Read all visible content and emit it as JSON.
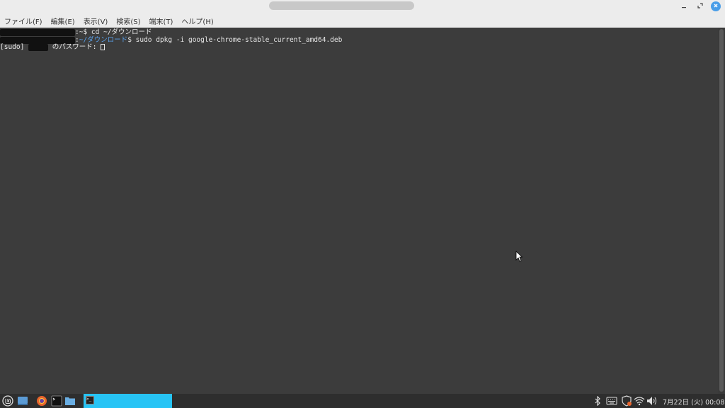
{
  "window": {
    "menu": [
      "ファイル(F)",
      "編集(E)",
      "表示(V)",
      "検索(S)",
      "端末(T)",
      "ヘルプ(H)"
    ]
  },
  "terminal": {
    "line1": {
      "prompt_sep": ":",
      "rest": "~$ cd ~/ダウンロード"
    },
    "line2": {
      "prompt_sep": ":",
      "path": "~/ダウンロード",
      "cmd": "$ sudo dpkg -i google-chrome-stable_current_amd64.deb"
    },
    "line3": {
      "prefix": "[sudo] ",
      "suffix": " のパスワード: "
    }
  },
  "taskbar": {
    "clock": "7月22日 (火) 00:08"
  },
  "icons": {
    "menu": "mint-menu-icon",
    "desktop": "show-desktop-icon",
    "firefox": "firefox-icon",
    "terminal": "terminal-icon",
    "files": "folder-icon",
    "bluetooth": "bluetooth-icon",
    "keyboard": "keyboard-icon",
    "update": "update-shield-icon",
    "wifi": "wifi-icon",
    "volume": "volume-icon"
  },
  "colors": {
    "terminal_bg": "#3c3c3c",
    "path": "#5aa0e8",
    "active_task": "#27c4f5",
    "close_button": "#4a9ee8"
  }
}
